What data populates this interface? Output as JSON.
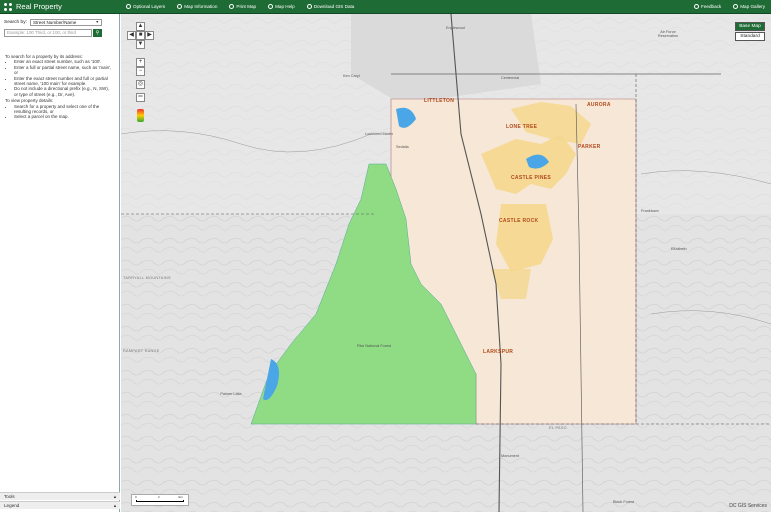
{
  "app": {
    "title": "Real Property"
  },
  "nav": [
    {
      "label": "Optional Layers",
      "icon": "layers-icon"
    },
    {
      "label": "Map Information",
      "icon": "info-icon"
    },
    {
      "label": "Print Map",
      "icon": "print-icon"
    },
    {
      "label": "Map Help",
      "icon": "help-icon"
    },
    {
      "label": "Download GIS Data",
      "icon": "download-icon"
    }
  ],
  "nav_right": [
    {
      "label": "Feedback",
      "icon": "feedback-icon"
    },
    {
      "label": "Map Gallery",
      "icon": "gallery-icon"
    }
  ],
  "search": {
    "label": "Search by:",
    "mode": "Street Number/Name",
    "placeholder": "Example: 100 Third, or 100, or third"
  },
  "help": {
    "address_heading": "To search for a property by its address:",
    "address_items": [
      "Enter an exact street number, such as '100'.",
      "Enter a full or partial street name, such as 'main', or",
      "Enter the exact street number and full or partial street name, '100 main' for example.",
      "Do not include a directional prefix (e.g., N, SW), or type of street (e.g., Dr, Ave)."
    ],
    "details_heading": "To view property details:",
    "details_items": [
      "Search for a property and select one of the resulting records, or",
      "Select a parcel on the map."
    ]
  },
  "panels": {
    "tools": "Tools",
    "legend": "Legend"
  },
  "basemap": {
    "active": "Base Map",
    "other": "Standard"
  },
  "map": {
    "cities": [
      "LITTLETON",
      "AURORA",
      "LONE TREE",
      "PARKER",
      "CASTLE PINES",
      "CASTLE ROCK",
      "LARKSPUR"
    ],
    "places": [
      "Englewood",
      "Centennial",
      "Ken Caryl",
      "Lockheed Martin",
      "Pike National Forest",
      "Franktown",
      "Elizabeth",
      "Sedalia",
      "Air Force Reservation",
      "Black Forest",
      "Monument",
      "Palmer Lake"
    ],
    "mountains": [
      "TARRYALL MOUNTAINS",
      "RAMPART RANGE"
    ],
    "county_label": "EL PASO",
    "credit": "DC GIS Services",
    "scale_labels": [
      "0",
      "2",
      "4mi"
    ]
  },
  "colors": {
    "header": "#1f6b35",
    "county": "#f7e7d6",
    "forest": "#8fdc84",
    "city": "#f4d78e",
    "water": "#4aa6e6"
  }
}
